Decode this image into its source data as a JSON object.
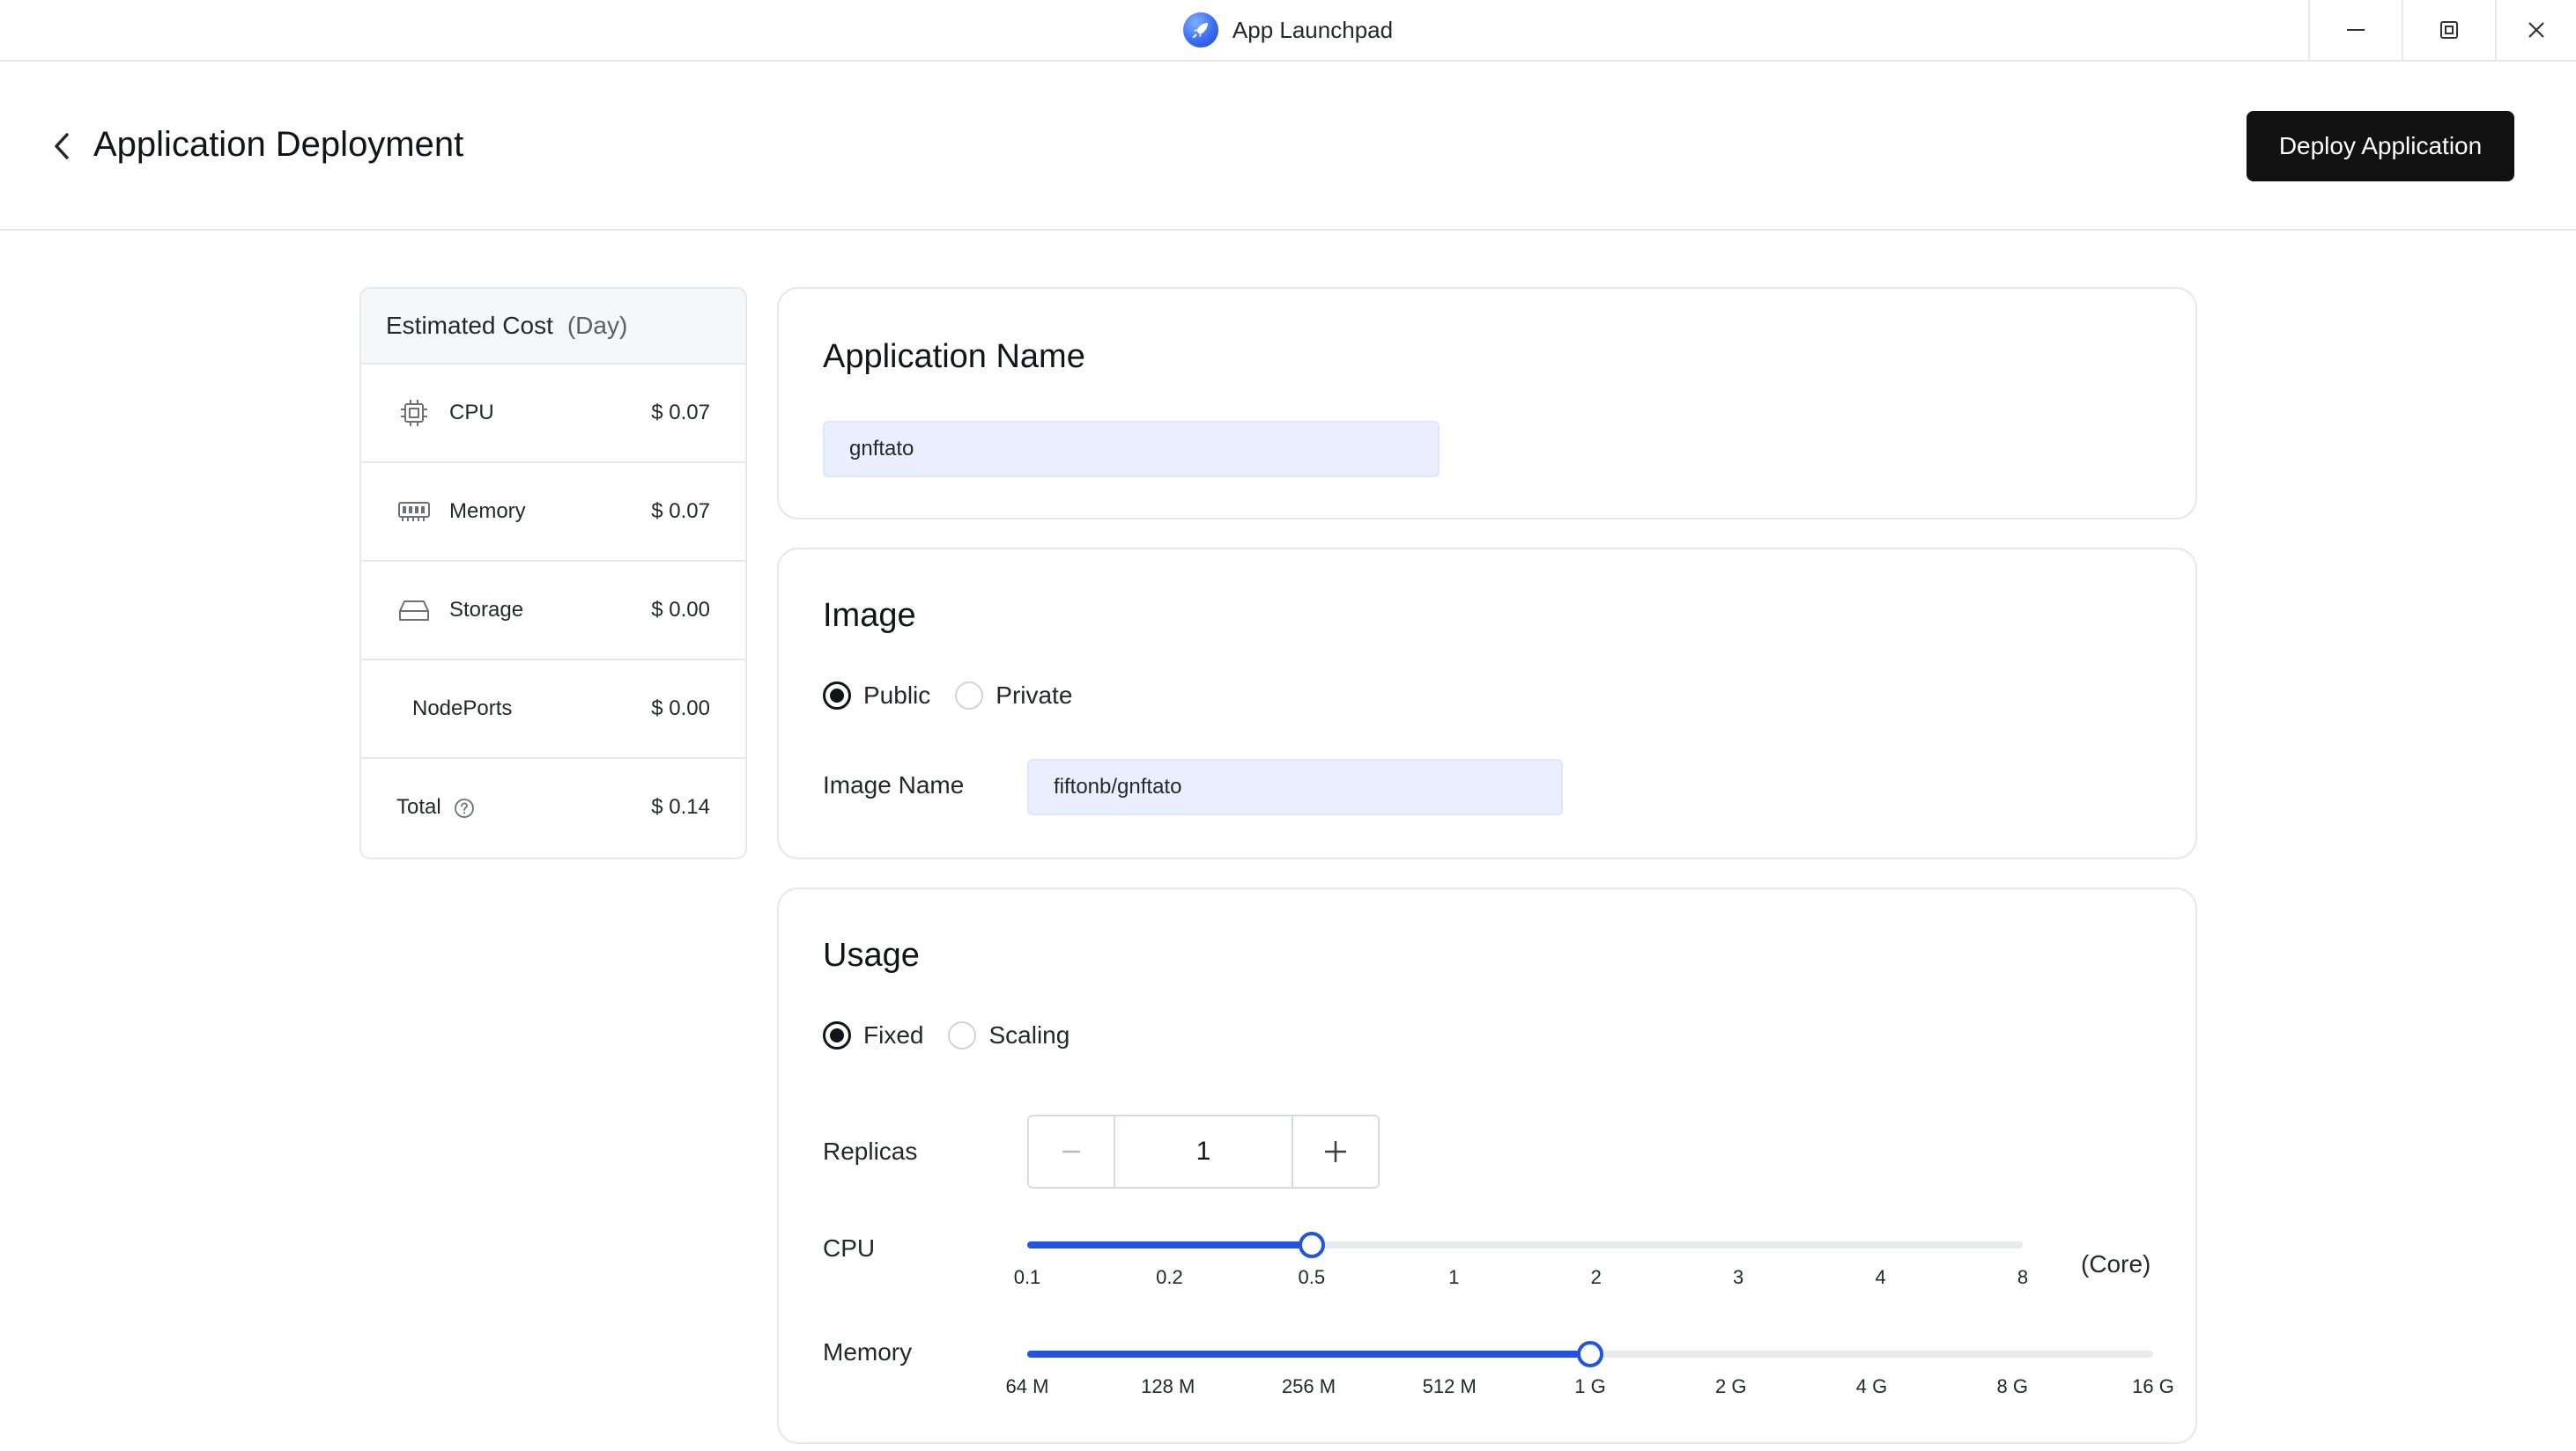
{
  "window": {
    "app_title": "App Launchpad",
    "logo_icon": "rocket-icon"
  },
  "header": {
    "title": "Application Deployment",
    "deploy_label": "Deploy Application"
  },
  "cost": {
    "title": "Estimated Cost",
    "unit": "(Day)",
    "rows": [
      {
        "label": "CPU",
        "value": "$ 0.07",
        "icon": "cpu-chip-icon"
      },
      {
        "label": "Memory",
        "value": "$ 0.07",
        "icon": "memory-module-icon"
      },
      {
        "label": "Storage",
        "value": "$ 0.00",
        "icon": "storage-drive-icon"
      },
      {
        "label": "NodePorts",
        "value": "$ 0.00"
      }
    ],
    "total_label": "Total",
    "total_value": "$ 0.14"
  },
  "app_name": {
    "title": "Application Name",
    "value": "gnftato"
  },
  "image": {
    "title": "Image",
    "options": [
      "Public",
      "Private"
    ],
    "selected": "Public",
    "name_label": "Image Name",
    "name_value": "fiftonb/gnftato"
  },
  "usage": {
    "title": "Usage",
    "options": [
      "Fixed",
      "Scaling"
    ],
    "selected": "Fixed",
    "replicas_label": "Replicas",
    "replicas_value": "1",
    "cpu": {
      "label": "CPU",
      "ticks": [
        "0.1",
        "0.2",
        "0.5",
        "1",
        "2",
        "3",
        "4",
        "8"
      ],
      "selected_index": 2,
      "unit": "(Core)"
    },
    "memory": {
      "label": "Memory",
      "ticks": [
        "64 M",
        "128 M",
        "256 M",
        "512 M",
        "1 G",
        "2 G",
        "4 G",
        "8 G",
        "16 G"
      ],
      "selected_index": 4
    }
  },
  "colors": {
    "accent": "#2453e0",
    "primary_button": "#111111",
    "input_bg": "#e9effc"
  }
}
